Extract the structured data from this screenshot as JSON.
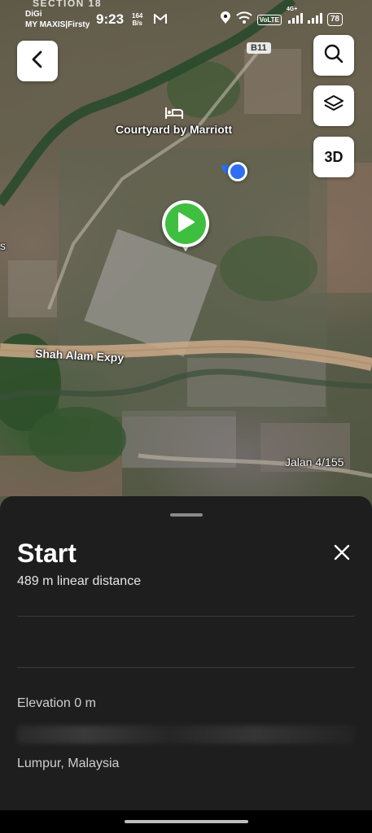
{
  "status_bar": {
    "section_label": "SECTION 18",
    "carrier_line1": "DiGi",
    "carrier_line2": "MY MAXIS|Firsty",
    "time": "9:23",
    "net_speed_value": "164",
    "net_speed_unit": "B/s",
    "volte_label": "VoLTE",
    "network_type": "4G+",
    "battery_level": "78"
  },
  "map": {
    "labels": {
      "hotel": "Courtyard by Marriott",
      "highway": "Shah Alam Expy",
      "road": "Jalan 4/155",
      "route_shield": "B11",
      "edge_fragment": "s"
    },
    "buttons": {
      "three_d_label": "3D"
    },
    "icons": {
      "back": "chevron-left-icon",
      "search": "search-icon",
      "layers": "layers-icon",
      "hotel": "bed-icon",
      "start_pin": "play-icon"
    },
    "colors": {
      "start_pin": "#3fbf3f",
      "location_dot": "#2f6ef0"
    }
  },
  "sheet": {
    "title": "Start",
    "subtitle": "489 m linear distance",
    "elevation": "Elevation 0 m",
    "location": "Lumpur, Malaysia"
  }
}
